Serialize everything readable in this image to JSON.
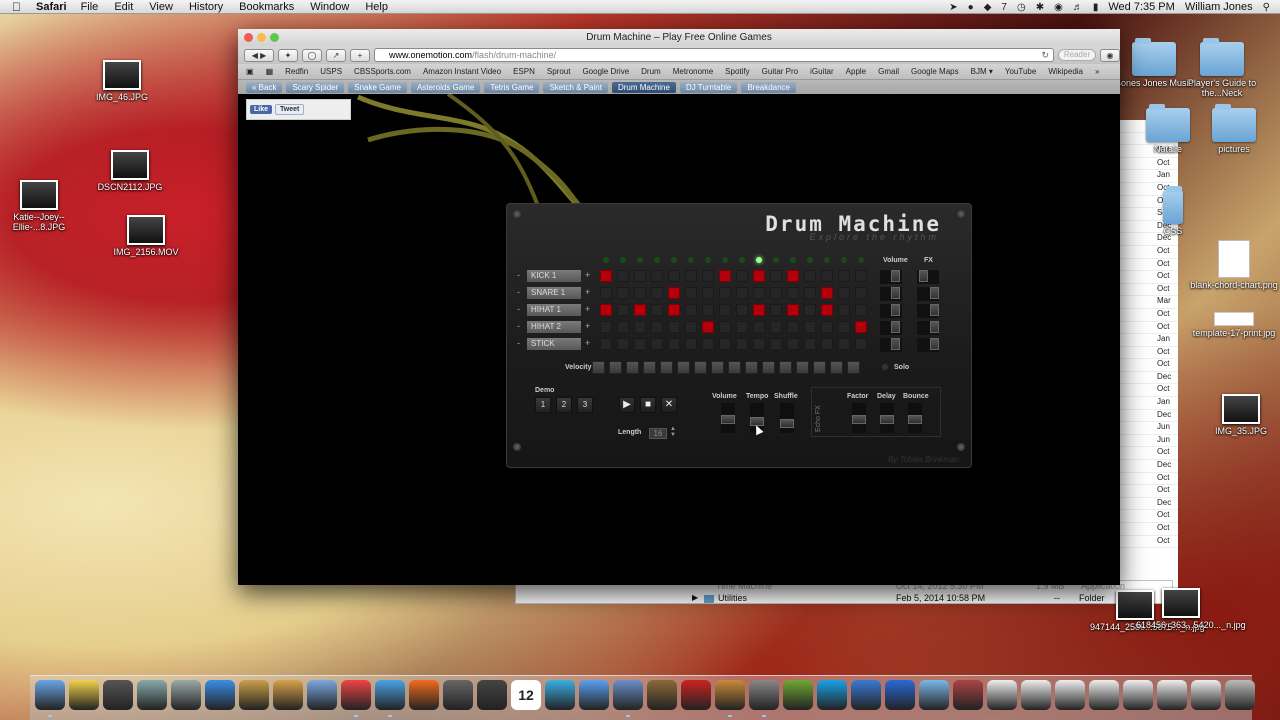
{
  "menubar": {
    "app": "Safari",
    "menus": [
      "File",
      "Edit",
      "View",
      "History",
      "Bookmarks",
      "Window",
      "Help"
    ],
    "clock": "Wed 7:35 PM",
    "user": "William Jones",
    "status_badge": "7"
  },
  "desktop_left": [
    {
      "label": "IMG_46.JPG"
    },
    {
      "label": "DSCN2112.JPG"
    },
    {
      "label": "Katie--Joey--Ellie-...8.JPG"
    },
    {
      "label": "IMG_2156.MOV"
    }
  ],
  "desktop_right": [
    {
      "label": "Bones Jones Music"
    },
    {
      "label": "Player's Guide to the...Neck"
    },
    {
      "label": "Natalie"
    },
    {
      "label": "pictures"
    },
    {
      "label": "CSS"
    },
    {
      "label": "blank-chord-chart.png"
    },
    {
      "label": "template-17-print.jpg"
    },
    {
      "label": "IMG_35.JPG"
    },
    {
      "label": "947144_2586...5575..._n.jpg"
    },
    {
      "label": "618456_363...5420..._n.jpg"
    }
  ],
  "finder_dates": [
    "Dat",
    "Apr",
    "Oct",
    "Oct",
    "Jan",
    "Oct",
    "Oct",
    "Sep",
    "Dec",
    "Dec",
    "Oct",
    "Oct",
    "Oct",
    "Oct",
    "Mar",
    "Oct",
    "Oct",
    "Jan",
    "Oct",
    "Oct",
    "Dec",
    "Oct",
    "Jan",
    "Dec",
    "Jun",
    "Jun",
    "Oct",
    "Dec",
    "Oct",
    "Oct",
    "Dec",
    "Oct",
    "Oct",
    "Oct"
  ],
  "finder_rows": [
    {
      "name": "Time Machine",
      "date": "Oct 14, 2012 5:30 PM",
      "size": "1.9 MB",
      "kind": "Application"
    },
    {
      "name": "Utilities",
      "date": "Feb 5, 2014 10:58 PM",
      "size": "--",
      "kind": "Folder"
    }
  ],
  "browser": {
    "window_title": "Drum Machine – Play Free Online Games",
    "url_host": "www.onemotion.com",
    "url_path": "/flash/drum-machine/",
    "reader_label": "Reader",
    "bookmarks": [
      "Redfin",
      "USPS",
      "CBSSports.com",
      "Amazon Instant Video",
      "ESPN",
      "Sprout",
      "Google Drive",
      "Drum",
      "Metronome",
      "Spotify",
      "Guitar Pro",
      "iGuitar",
      "Apple",
      "Gmail",
      "Google Maps",
      "BJM ▾",
      "YouTube",
      "Wikipedia",
      "»"
    ],
    "site_tabs": [
      "« Back",
      "Scary Spider",
      "Snake Game",
      "Asteroids Game",
      "Tetris Game",
      "Sketch & Paint",
      "Drum Machine",
      "DJ Turntable",
      "Breakdance"
    ],
    "active_tab": "Drum Machine",
    "share": {
      "like": "Like",
      "tweet": "Tweet"
    }
  },
  "drum_machine": {
    "title": "Drum Machine",
    "subtitle": "Explore the rhythm",
    "credit": "By Tobias Brinkman",
    "active_step": 9,
    "tracks": [
      {
        "name": "KICK 1",
        "steps": [
          1,
          0,
          0,
          0,
          0,
          0,
          0,
          1,
          0,
          1,
          0,
          1,
          0,
          0,
          0,
          0
        ]
      },
      {
        "name": "SNARE 1",
        "steps": [
          0,
          0,
          0,
          0,
          1,
          0,
          0,
          0,
          0,
          0,
          0,
          0,
          0,
          1,
          0,
          0
        ]
      },
      {
        "name": "HIHAT 1",
        "steps": [
          1,
          0,
          1,
          0,
          1,
          0,
          0,
          0,
          0,
          1,
          0,
          1,
          0,
          1,
          0,
          0
        ]
      },
      {
        "name": "HIHAT 2",
        "steps": [
          0,
          0,
          0,
          0,
          0,
          0,
          1,
          0,
          0,
          0,
          0,
          0,
          0,
          0,
          0,
          1
        ]
      },
      {
        "name": "STICK",
        "steps": [
          0,
          0,
          0,
          0,
          0,
          0,
          0,
          0,
          0,
          0,
          0,
          0,
          0,
          0,
          0,
          0
        ]
      }
    ],
    "labels": {
      "volume": "Volume",
      "fx": "FX",
      "velocity": "Velocity",
      "solo": "Solo",
      "demo": "Demo",
      "length": "Length",
      "master_volume": "Volume",
      "tempo": "Tempo",
      "shuffle": "Shuffle",
      "echo_fx": "Echo FX",
      "factor": "Factor",
      "delay": "Delay",
      "bounce": "Bounce"
    },
    "demo_buttons": [
      "1",
      "2",
      "3"
    ],
    "transport": {
      "play": "▶",
      "stop": "■",
      "clear": "✕"
    },
    "length_value": "16",
    "plus": "+",
    "minus": "-"
  },
  "dock": {
    "icons": [
      "finder-icon",
      "notes-icon",
      "photo-booth-icon",
      "preview-icon",
      "launchpad-icon",
      "app-store-icon",
      "imovie-icon",
      "garageband-icon",
      "mail-icon",
      "chrome-icon",
      "safari-icon",
      "firefox-icon",
      "facetime-icon",
      "guitar-pro-icon",
      "calendar-icon",
      "compass-icon",
      "itunes-icon",
      "iphoto-icon",
      "photo-app-icon",
      "flashcard-icon",
      "presentation-icon",
      "system-preferences-icon",
      "dreamweaver-icon",
      "skype-icon",
      "sync-icon",
      "quicktime-icon",
      "downloads-icon",
      "photo-stack-icon",
      "document-icon",
      "document-icon",
      "document-icon",
      "document-icon",
      "document-icon",
      "document-icon",
      "document-icon",
      "trash-icon"
    ],
    "calendar_day": "12"
  }
}
